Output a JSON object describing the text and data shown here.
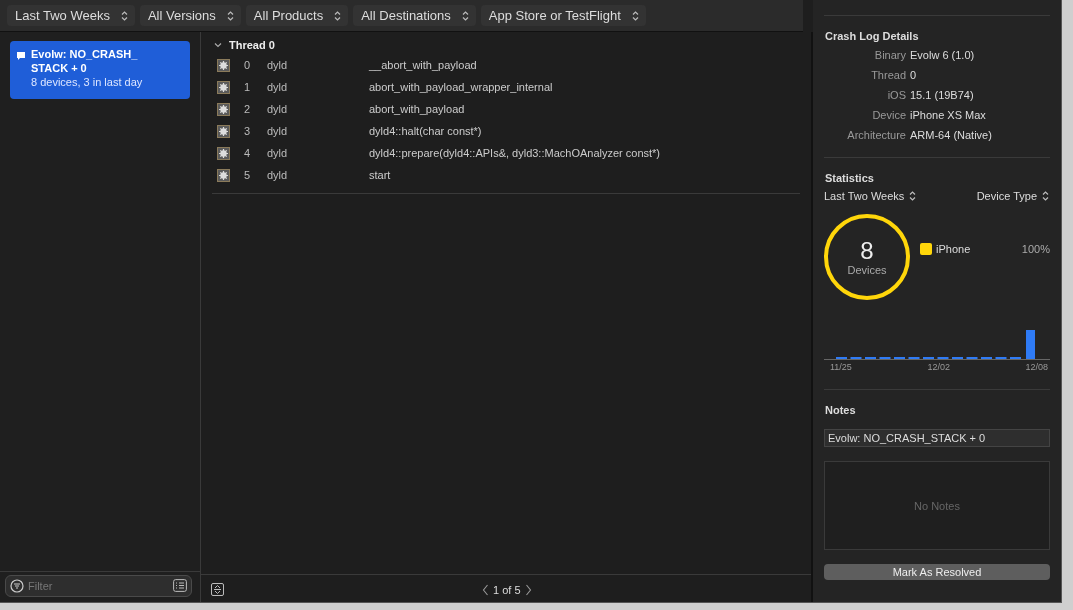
{
  "toolbar": {
    "filters": [
      "Last Two Weeks",
      "All Versions",
      "All Products",
      "All Destinations",
      "App Store or TestFlight"
    ]
  },
  "sidebar": {
    "items": [
      {
        "title": "Evolw: NO_CRASH_\nSTACK + 0",
        "subtitle": "8 devices, 3 in last day",
        "selected": true
      }
    ],
    "filter": {
      "placeholder": "Filter"
    }
  },
  "thread": {
    "title": "Thread 0",
    "expanded": true,
    "frames": [
      {
        "index": "0",
        "library": "dyld",
        "symbol": "__abort_with_payload"
      },
      {
        "index": "1",
        "library": "dyld",
        "symbol": "abort_with_payload_wrapper_internal"
      },
      {
        "index": "2",
        "library": "dyld",
        "symbol": "abort_with_payload"
      },
      {
        "index": "3",
        "library": "dyld",
        "symbol": "dyld4::halt(char const*)"
      },
      {
        "index": "4",
        "library": "dyld",
        "symbol": "dyld4::prepare(dyld4::APIs&, dyld3::MachOAnalyzer const*)"
      },
      {
        "index": "5",
        "library": "dyld",
        "symbol": "start"
      }
    ]
  },
  "pager": "1 of 5",
  "inspector": {
    "details_title": "Crash Log Details",
    "details": [
      {
        "label": "Binary",
        "value": "Evolw 6 (1.0)"
      },
      {
        "label": "Thread",
        "value": "0"
      },
      {
        "label": "iOS",
        "value": "15.1 (19B74)"
      },
      {
        "label": "Device",
        "value": "iPhone XS Max"
      },
      {
        "label": "Architecture",
        "value": "ARM-64 (Native)"
      }
    ],
    "statistics_title": "Statistics",
    "period": "Last Two Weeks",
    "grouping": "Device Type",
    "total": "8",
    "total_label": "Devices",
    "legend": [
      {
        "name": "iPhone",
        "share": "100%",
        "color": "#ffd60a"
      }
    ],
    "axis_labels": [
      "11/25",
      "12/02",
      "12/08"
    ],
    "notes_title": "Notes",
    "note_title": "Evolw: NO_CRASH_STACK + 0",
    "notes_placeholder": "No Notes",
    "resolve_button": "Mark As Resolved"
  }
}
